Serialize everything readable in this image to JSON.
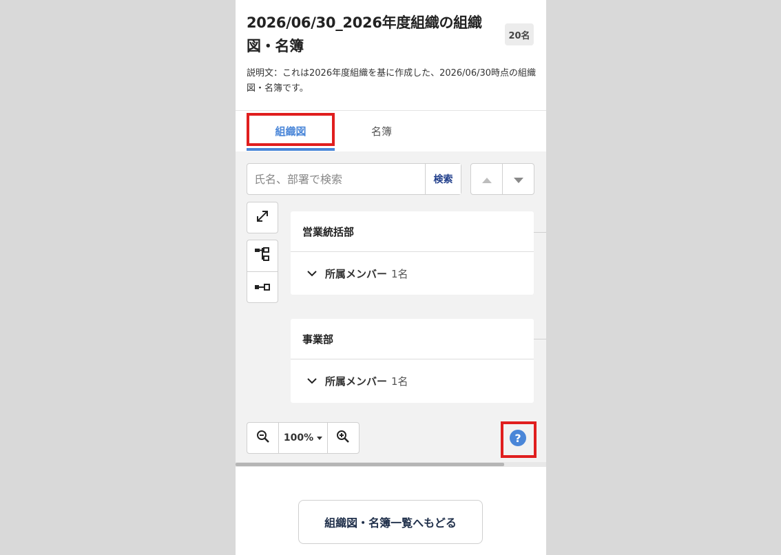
{
  "header": {
    "title": "2026/06/30_2026年度組織の組織図・名簿",
    "count_badge": "20名",
    "description": "説明文：これは2026年度組織を基に作成した、2026/06/30時点の組織図・名簿です。"
  },
  "tabs": [
    {
      "label": "組織図",
      "active": true
    },
    {
      "label": "名簿",
      "active": false
    }
  ],
  "search": {
    "placeholder": "氏名、部署で検索",
    "button_label": "検索"
  },
  "nav_buttons": {
    "up_icon": "triangle-up-icon",
    "down_icon": "triangle-down-icon"
  },
  "tools": {
    "expand_icon": "expand-diagonal-icon",
    "tree_icon": "tree-layout-icon",
    "flat_icon": "flat-layout-icon"
  },
  "org_cards": [
    {
      "name": "営業統括部",
      "members_label": "所属メンバー",
      "members_count": "1名"
    },
    {
      "name": "事業部",
      "members_label": "所属メンバー",
      "members_count": "1名"
    }
  ],
  "zoom": {
    "level": "100%"
  },
  "help": {
    "symbol": "?"
  },
  "footer": {
    "back_button": "組織図・名簿一覧へもどる"
  },
  "colors": {
    "accent": "#4a86d8",
    "highlight": "#e01e1e",
    "canvas_bg": "#f2f2f2"
  }
}
